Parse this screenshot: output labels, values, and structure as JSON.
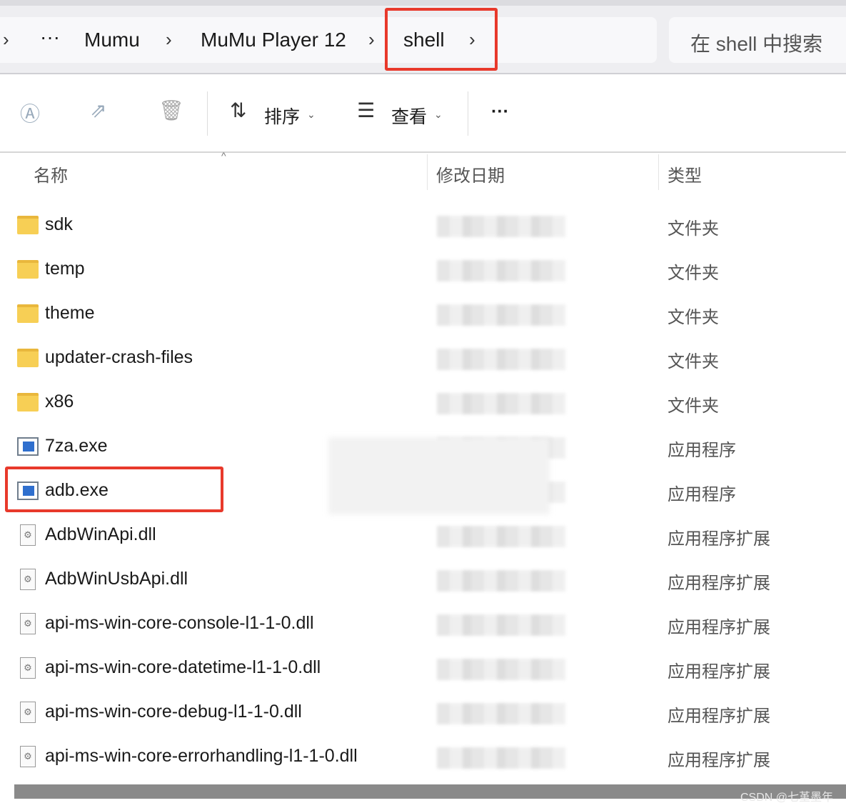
{
  "breadcrumb": {
    "ellipsis": "···",
    "items": [
      "Mumu",
      "MuMu Player 12",
      "shell"
    ],
    "chevron": "›"
  },
  "search": {
    "placeholder": "在 shell 中搜索"
  },
  "toolbar": {
    "sort_label": "排序",
    "view_label": "查看",
    "more": "···",
    "rename_icon": "rename-icon",
    "share_icon": "share-icon",
    "delete_icon": "trash-icon"
  },
  "columns": {
    "name": "名称",
    "modified": "修改日期",
    "type": "类型"
  },
  "files": [
    {
      "name": "sdk",
      "kind": "folder",
      "type": "文件夹"
    },
    {
      "name": "temp",
      "kind": "folder",
      "type": "文件夹"
    },
    {
      "name": "theme",
      "kind": "folder",
      "type": "文件夹"
    },
    {
      "name": "updater-crash-files",
      "kind": "folder",
      "type": "文件夹"
    },
    {
      "name": "x86",
      "kind": "folder",
      "type": "文件夹"
    },
    {
      "name": "7za.exe",
      "kind": "exe",
      "type": "应用程序"
    },
    {
      "name": "adb.exe",
      "kind": "exe",
      "type": "应用程序"
    },
    {
      "name": "AdbWinApi.dll",
      "kind": "dll",
      "type": "应用程序扩展"
    },
    {
      "name": "AdbWinUsbApi.dll",
      "kind": "dll",
      "type": "应用程序扩展"
    },
    {
      "name": "api-ms-win-core-console-l1-1-0.dll",
      "kind": "dll",
      "type": "应用程序扩展"
    },
    {
      "name": "api-ms-win-core-datetime-l1-1-0.dll",
      "kind": "dll",
      "type": "应用程序扩展"
    },
    {
      "name": "api-ms-win-core-debug-l1-1-0.dll",
      "kind": "dll",
      "type": "应用程序扩展"
    },
    {
      "name": "api-ms-win-core-errorhandling-l1-1-0.dll",
      "kind": "dll",
      "type": "应用程序扩展"
    }
  ],
  "watermark": "CSDN @七堇墨年",
  "colors": {
    "highlight": "#e8392b",
    "accent": "#2f6fce"
  }
}
